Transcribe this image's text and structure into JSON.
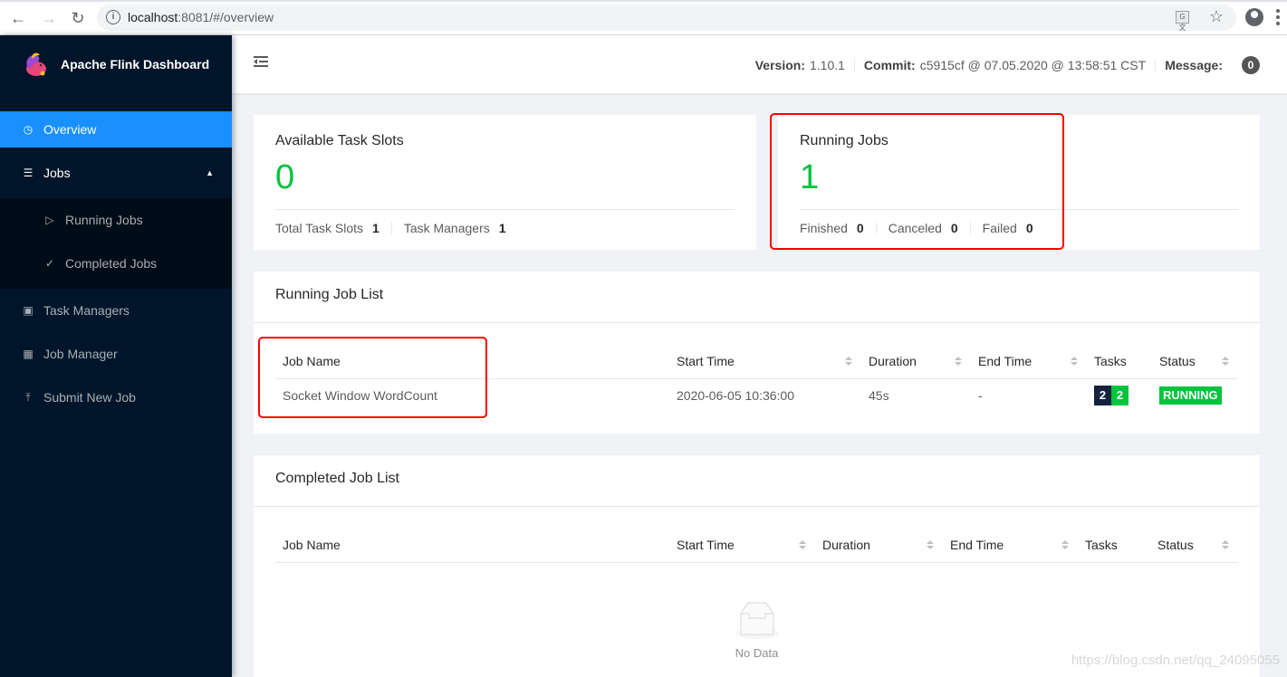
{
  "browser": {
    "url_host": "localhost",
    "url_rest": ":8081/#/overview",
    "back_icon": "arrow-left-icon",
    "forward_icon": "arrow-right-icon",
    "reload_icon": "reload-icon",
    "info_icon": "i"
  },
  "sidebar": {
    "title": "Apache Flink Dashboard",
    "items": [
      {
        "label": "Overview",
        "icon": "dashboard-icon",
        "active": true
      },
      {
        "label": "Jobs",
        "icon": "list-icon",
        "expanded": true,
        "children": [
          {
            "label": "Running Jobs",
            "icon": "play-circle-icon"
          },
          {
            "label": "Completed Jobs",
            "icon": "check-circle-icon"
          }
        ]
      },
      {
        "label": "Task Managers",
        "icon": "schedule-icon"
      },
      {
        "label": "Job Manager",
        "icon": "build-icon"
      },
      {
        "label": "Submit New Job",
        "icon": "upload-icon"
      }
    ]
  },
  "header": {
    "version_label": "Version:",
    "version_value": "1.10.1",
    "commit_label": "Commit:",
    "commit_value": "c5915cf @ 07.05.2020 @ 13:58:51 CST",
    "message_label": "Message:",
    "message_count": "0"
  },
  "stats": {
    "slots": {
      "title": "Available Task Slots",
      "value": "0",
      "footer": [
        {
          "label": "Total Task Slots",
          "value": "1"
        },
        {
          "label": "Task Managers",
          "value": "1"
        }
      ]
    },
    "jobs": {
      "title": "Running Jobs",
      "value": "1",
      "footer": [
        {
          "label": "Finished",
          "value": "0"
        },
        {
          "label": "Canceled",
          "value": "0"
        },
        {
          "label": "Failed",
          "value": "0"
        }
      ]
    }
  },
  "running_list": {
    "title": "Running Job List",
    "columns": [
      "Job Name",
      "Start Time",
      "Duration",
      "End Time",
      "Tasks",
      "Status"
    ],
    "rows": [
      {
        "name": "Socket Window WordCount",
        "start": "2020-06-05 10:36:00",
        "duration": "45s",
        "end": "-",
        "tasks_total": "2",
        "tasks_running": "2",
        "status": "RUNNING"
      }
    ]
  },
  "completed_list": {
    "title": "Completed Job List",
    "columns": [
      "Job Name",
      "Start Time",
      "Duration",
      "End Time",
      "Tasks",
      "Status"
    ],
    "empty_text": "No Data"
  },
  "colors": {
    "accent": "#1890ff",
    "success": "#00c43c",
    "sidebar_bg": "#001529",
    "highlight": "#ff0000"
  },
  "watermark": "https://blog.csdn.net/qq_24095055"
}
